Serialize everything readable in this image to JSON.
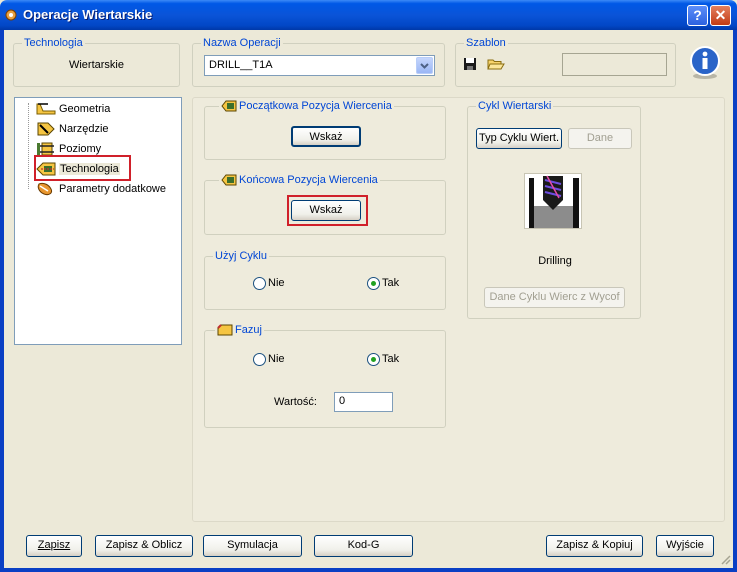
{
  "window": {
    "title": "Operacje Wiertarskie",
    "help_glyph": "?",
    "close_glyph": "✕"
  },
  "technologia": {
    "label": "Technologia",
    "value": "Wiertarskie"
  },
  "nazwa_operacji": {
    "label": "Nazwa Operacji",
    "value": "DRILL__T1A"
  },
  "szablon": {
    "label": "Szablon",
    "value": ""
  },
  "tree": {
    "items": [
      {
        "label": "Geometria",
        "icon": "geometry-icon"
      },
      {
        "label": "Narzędzie",
        "icon": "tool-icon"
      },
      {
        "label": "Poziomy",
        "icon": "levels-icon"
      },
      {
        "label": "Technologia",
        "icon": "technology-icon",
        "selected": true
      },
      {
        "label": "Parametry dodatkowe",
        "icon": "extra-params-icon"
      }
    ]
  },
  "start_position": {
    "label": "Początkowa Pozycja Wiercenia",
    "button": "Wskaż"
  },
  "end_position": {
    "label": "Końcowa Pozycja Wiercenia",
    "button": "Wskaż"
  },
  "use_cycle": {
    "label": "Użyj Cyklu",
    "no": "Nie",
    "yes": "Tak",
    "selected": "Tak"
  },
  "chamfer": {
    "label": "Fazuj",
    "no": "Nie",
    "yes": "Tak",
    "selected": "Tak",
    "value_label": "Wartość:",
    "value": "0"
  },
  "cycle": {
    "label": "Cykl Wiertarski",
    "type_button": "Typ Cyklu Wiert.",
    "data_button": "Dane",
    "preview_caption": "Drilling",
    "withdraw_button": "Dane Cyklu Wierc z Wycof"
  },
  "footer": {
    "save": "Zapisz",
    "save_calc": "Zapisz & Oblicz",
    "simulation": "Symulacja",
    "gcode": "Kod-G",
    "save_copy": "Zapisz & Kopiuj",
    "exit": "Wyjście"
  },
  "colors": {
    "accent": "#0046d5",
    "highlight": "#d0202a",
    "selection": "#316ac5"
  }
}
